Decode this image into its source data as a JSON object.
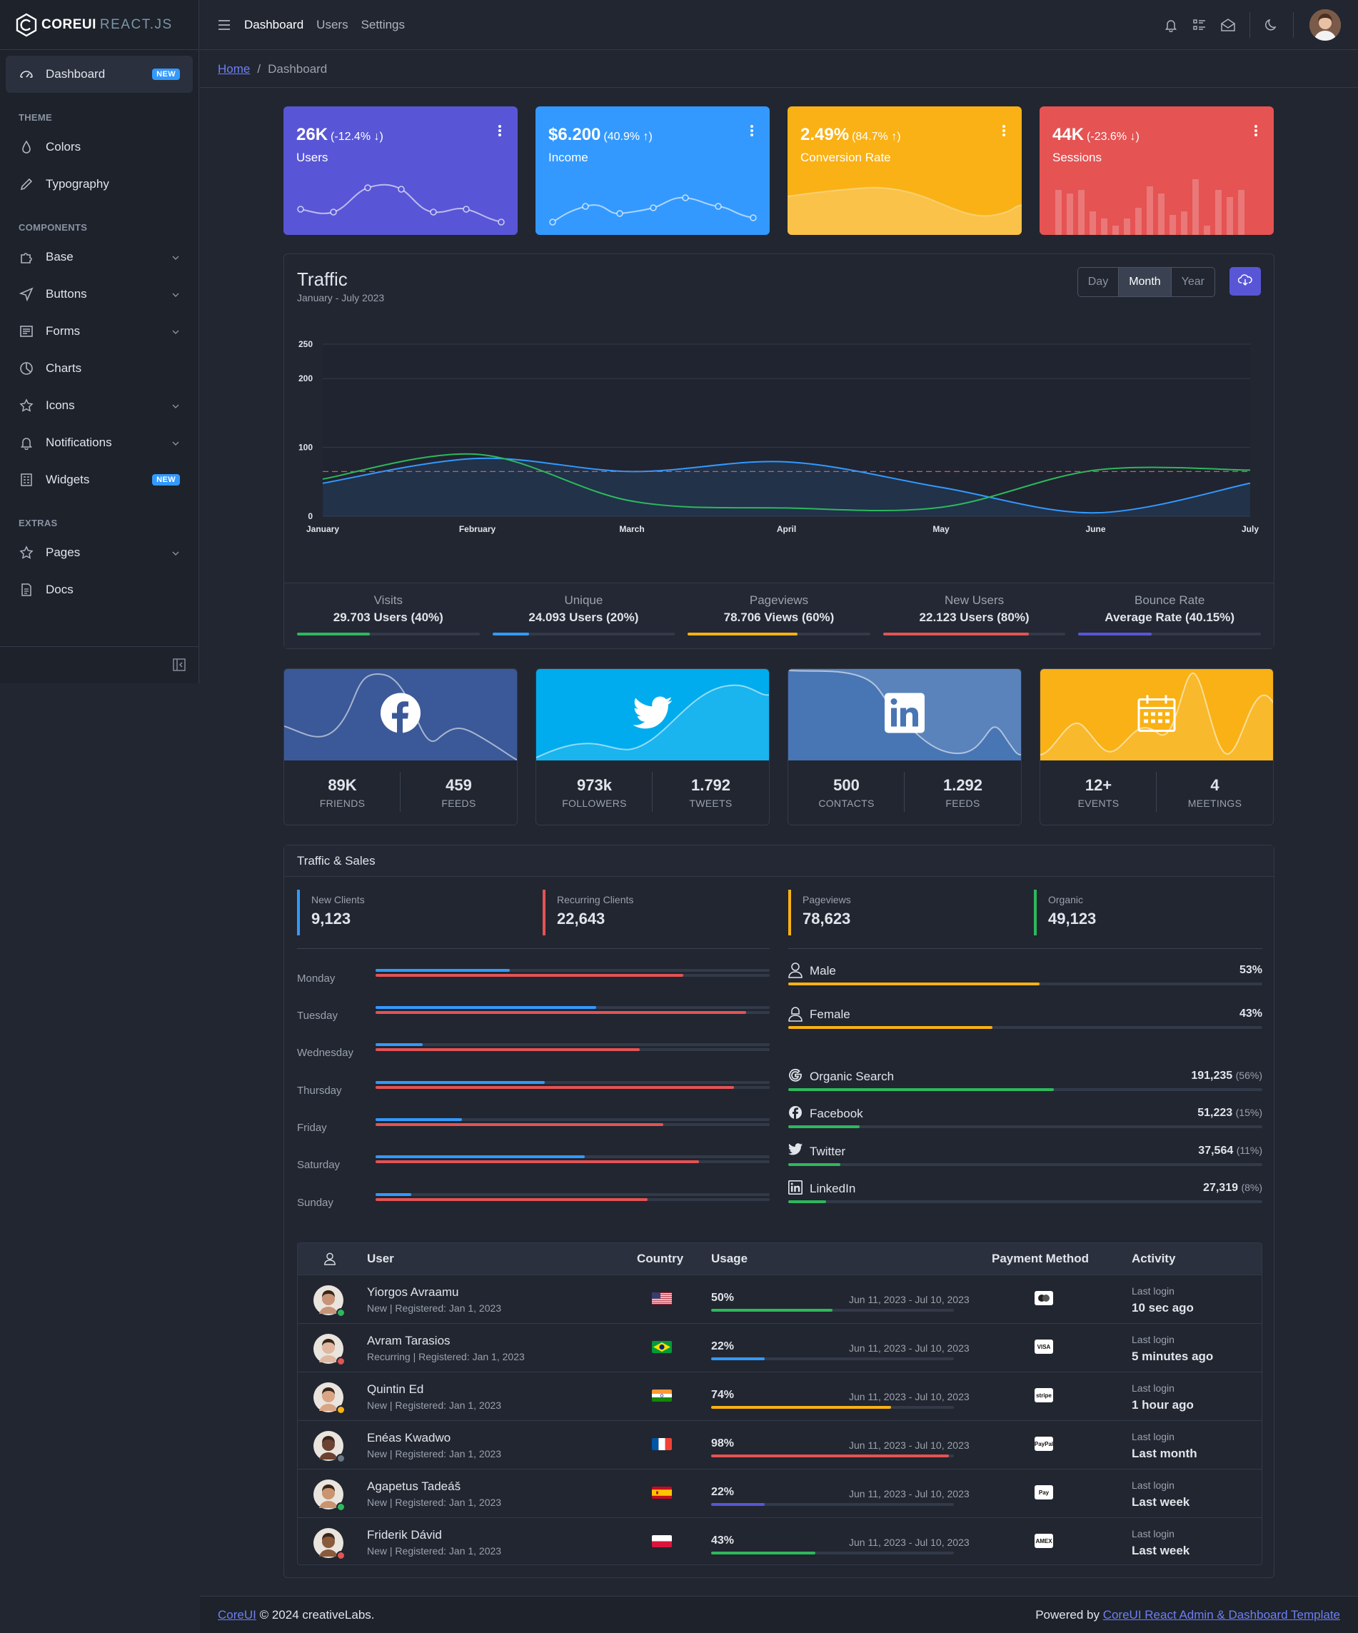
{
  "brand": {
    "core": "COREUI",
    "react": "REACT.JS"
  },
  "sidebar": {
    "dashboard": {
      "label": "Dashboard",
      "badge": "NEW"
    },
    "theme_title": "THEME",
    "colors": "Colors",
    "typography": "Typography",
    "components_title": "COMPONENTS",
    "base": "Base",
    "buttons": "Buttons",
    "forms": "Forms",
    "charts": "Charts",
    "icons": "Icons",
    "notifications": "Notifications",
    "widgets": {
      "label": "Widgets",
      "badge": "NEW"
    },
    "extras_title": "EXTRAS",
    "pages": "Pages",
    "docs": "Docs"
  },
  "header": {
    "nav": [
      "Dashboard",
      "Users",
      "Settings"
    ]
  },
  "breadcrumb": {
    "home": "Home",
    "current": "Dashboard"
  },
  "widgets": [
    {
      "value": "26K",
      "change": "(-12.4% ↓)",
      "label": "Users",
      "color": "#5856d6"
    },
    {
      "value": "$6.200",
      "change": "(40.9% ↑)",
      "label": "Income",
      "color": "#3399ff"
    },
    {
      "value": "2.49%",
      "change": "(84.7% ↑)",
      "label": "Conversion Rate",
      "color": "#f9b115"
    },
    {
      "value": "44K",
      "change": "(-23.6% ↓)",
      "label": "Sessions",
      "color": "#e55353"
    }
  ],
  "traffic": {
    "title": "Traffic",
    "subtitle": "January - July 2023",
    "ranges": [
      "Day",
      "Month",
      "Year"
    ],
    "selected_range": "Month",
    "stats": [
      {
        "title": "Visits",
        "value": "29.703 Users (40%)",
        "percent": 40,
        "color": "#2eb85c"
      },
      {
        "title": "Unique",
        "value": "24.093 Users (20%)",
        "percent": 20,
        "color": "#3399ff"
      },
      {
        "title": "Pageviews",
        "value": "78.706 Views (60%)",
        "percent": 60,
        "color": "#f9b115"
      },
      {
        "title": "New Users",
        "value": "22.123 Users (80%)",
        "percent": 80,
        "color": "#e55353"
      },
      {
        "title": "Bounce Rate",
        "value": "Average Rate (40.15%)",
        "percent": 40.15,
        "color": "#5856d6"
      }
    ]
  },
  "chart_data": {
    "type": "line",
    "categories": [
      "January",
      "February",
      "March",
      "April",
      "May",
      "June",
      "July"
    ],
    "y_ticks": [
      "0",
      "100",
      "200",
      "250"
    ],
    "ylim": [
      0,
      250
    ],
    "series": [
      {
        "color": "#3399ff",
        "fill": true,
        "values": [
          48,
          84,
          65,
          79,
          42,
          5,
          48
        ]
      },
      {
        "color": "#2eb85c",
        "values": [
          54,
          90,
          22,
          12,
          13,
          67,
          67
        ]
      },
      {
        "color": "#e55353",
        "dashed": true,
        "values": [
          65,
          65,
          65,
          65,
          65,
          65,
          65
        ]
      }
    ]
  },
  "social": [
    {
      "network": "facebook",
      "bg": "#3b5998",
      "n1": "89K",
      "t1": "FRIENDS",
      "n2": "459",
      "t2": "FEEDS"
    },
    {
      "network": "twitter",
      "bg": "#00aced",
      "n1": "973k",
      "t1": "FOLLOWERS",
      "n2": "1.792",
      "t2": "TWEETS"
    },
    {
      "network": "linkedin",
      "bg": "#4875b4",
      "n1": "500",
      "t1": "CONTACTS",
      "n2": "1.292",
      "t2": "FEEDS"
    },
    {
      "network": "calendar",
      "bg": "#f9b115",
      "n1": "12+",
      "t1": "EVENTS",
      "n2": "4",
      "t2": "MEETINGS"
    }
  ],
  "traffic_sales": {
    "title": "Traffic & Sales",
    "kpis": [
      {
        "label": "New Clients",
        "value": "9,123",
        "color": "#3399ff"
      },
      {
        "label": "Recurring Clients",
        "value": "22,643",
        "color": "#e55353"
      },
      {
        "label": "Pageviews",
        "value": "78,623",
        "color": "#f9b115"
      },
      {
        "label": "Organic",
        "value": "49,123",
        "color": "#2eb85c"
      }
    ],
    "days": [
      {
        "day": "Monday",
        "new": 34,
        "recurring": 78
      },
      {
        "day": "Tuesday",
        "new": 56,
        "recurring": 94
      },
      {
        "day": "Wednesday",
        "new": 12,
        "recurring": 67
      },
      {
        "day": "Thursday",
        "new": 43,
        "recurring": 91
      },
      {
        "day": "Friday",
        "new": 22,
        "recurring": 73
      },
      {
        "day": "Saturday",
        "new": 53,
        "recurring": 82
      },
      {
        "day": "Sunday",
        "new": 9,
        "recurring": 69
      }
    ],
    "gender": [
      {
        "label": "Male",
        "value": "53%",
        "percent": 53,
        "icon": "user-icon"
      },
      {
        "label": "Female",
        "value": "43%",
        "percent": 43,
        "icon": "user-female-icon"
      }
    ],
    "sources": [
      {
        "label": "Organic Search",
        "value": "191,235",
        "pct": "(56%)",
        "percent": 56,
        "icon": "google-icon"
      },
      {
        "label": "Facebook",
        "value": "51,223",
        "pct": "(15%)",
        "percent": 15,
        "icon": "facebook-icon"
      },
      {
        "label": "Twitter",
        "value": "37,564",
        "pct": "(11%)",
        "percent": 11,
        "icon": "twitter-icon"
      },
      {
        "label": "LinkedIn",
        "value": "27,319",
        "pct": "(8%)",
        "percent": 8,
        "icon": "linkedin-icon"
      }
    ]
  },
  "users_table": {
    "headers": {
      "user": "User",
      "country": "Country",
      "usage": "Usage",
      "payment": "Payment Method",
      "activity": "Activity"
    },
    "rows": [
      {
        "name": "Yiorgos Avraamu",
        "meta": "New | Registered: Jan 1, 2023",
        "country": "us",
        "usage": "50%",
        "percent": 50,
        "period": "Jun 11, 2023 - Jul 10, 2023",
        "bar": "#2eb85c",
        "payment": "mastercard",
        "last_label": "Last login",
        "last": "10 sec ago",
        "status": "#2eb85c",
        "skin": "#c89478"
      },
      {
        "name": "Avram Tarasios",
        "meta": "Recurring | Registered: Jan 1, 2023",
        "country": "br",
        "usage": "22%",
        "percent": 22,
        "period": "Jun 11, 2023 - Jul 10, 2023",
        "bar": "#3399ff",
        "payment": "VISA",
        "last_label": "Last login",
        "last": "5 minutes ago",
        "status": "#e55353",
        "skin": "#e0b7a0"
      },
      {
        "name": "Quintin Ed",
        "meta": "New | Registered: Jan 1, 2023",
        "country": "in",
        "usage": "74%",
        "percent": 74,
        "period": "Jun 11, 2023 - Jul 10, 2023",
        "bar": "#f9b115",
        "payment": "stripe",
        "last_label": "Last login",
        "last": "1 hour ago",
        "status": "#f9b115",
        "skin": "#d9a585"
      },
      {
        "name": "Enéas Kwadwo",
        "meta": "New | Registered: Jan 1, 2023",
        "country": "fr",
        "usage": "98%",
        "percent": 98,
        "period": "Jun 11, 2023 - Jul 10, 2023",
        "bar": "#e55353",
        "payment": "PayPal",
        "last_label": "Last login",
        "last": "Last month",
        "status": "#6b7785",
        "skin": "#6b4330"
      },
      {
        "name": "Agapetus Tadeáš",
        "meta": "New | Registered: Jan 1, 2023",
        "country": "es",
        "usage": "22%",
        "percent": 22,
        "period": "Jun 11, 2023 - Jul 10, 2023",
        "bar": "#5856d6",
        "payment": "Pay",
        "last_label": "Last login",
        "last": "Last week",
        "status": "#2eb85c",
        "skin": "#c9946f"
      },
      {
        "name": "Friderik Dávid",
        "meta": "New | Registered: Jan 1, 2023",
        "country": "pl",
        "usage": "43%",
        "percent": 43,
        "period": "Jun 11, 2023 - Jul 10, 2023",
        "bar": "#2eb85c",
        "payment": "AMEX",
        "last_label": "Last login",
        "last": "Last week",
        "status": "#e55353",
        "skin": "#8a5a3c"
      }
    ]
  },
  "footer": {
    "left_link": "CoreUI",
    "left_text": "© 2024 creativeLabs.",
    "right_text": "Powered by",
    "right_link": "CoreUI React Admin & Dashboard Template"
  }
}
